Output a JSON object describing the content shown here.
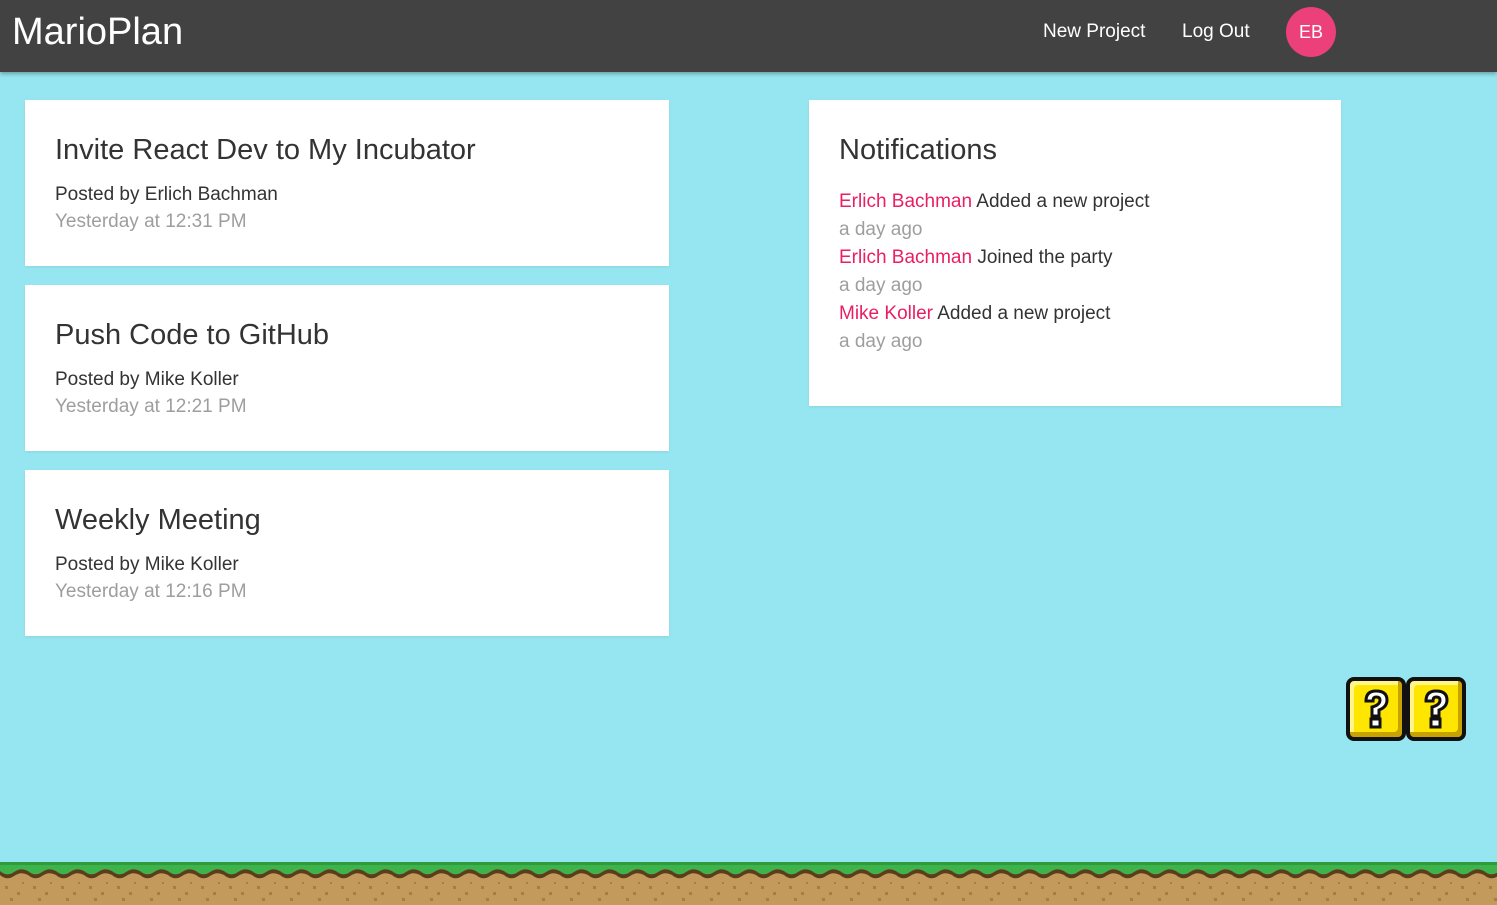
{
  "app": {
    "brand": "MarioPlan",
    "colors": {
      "nav_bg": "#424242",
      "page_bg": "#96e6f1",
      "accent": "#ec407a",
      "link": "#e91e63"
    }
  },
  "nav": {
    "new_project": "New Project",
    "logout": "Log Out",
    "avatar_initials": "EB"
  },
  "projects": [
    {
      "title": "Invite React Dev to My Incubator",
      "author": "Posted by Erlich Bachman",
      "date": "Yesterday at 12:31 PM"
    },
    {
      "title": "Push Code to GitHub",
      "author": "Posted by Mike Koller",
      "date": "Yesterday at 12:21 PM"
    },
    {
      "title": "Weekly Meeting",
      "author": "Posted by Mike Koller",
      "date": "Yesterday at 12:16 PM"
    }
  ],
  "notifications": {
    "title": "Notifications",
    "items": [
      {
        "user": "Erlich Bachman",
        "text": "Added a new project",
        "time": "a day ago"
      },
      {
        "user": "Erlich Bachman",
        "text": "Joined the party",
        "time": "a day ago"
      },
      {
        "user": "Mike Koller",
        "text": "Added a new project",
        "time": "a day ago"
      }
    ]
  },
  "decorations": {
    "question_blocks": [
      "question-block-icon",
      "question-block-icon"
    ],
    "ground": "ground-tiles"
  }
}
